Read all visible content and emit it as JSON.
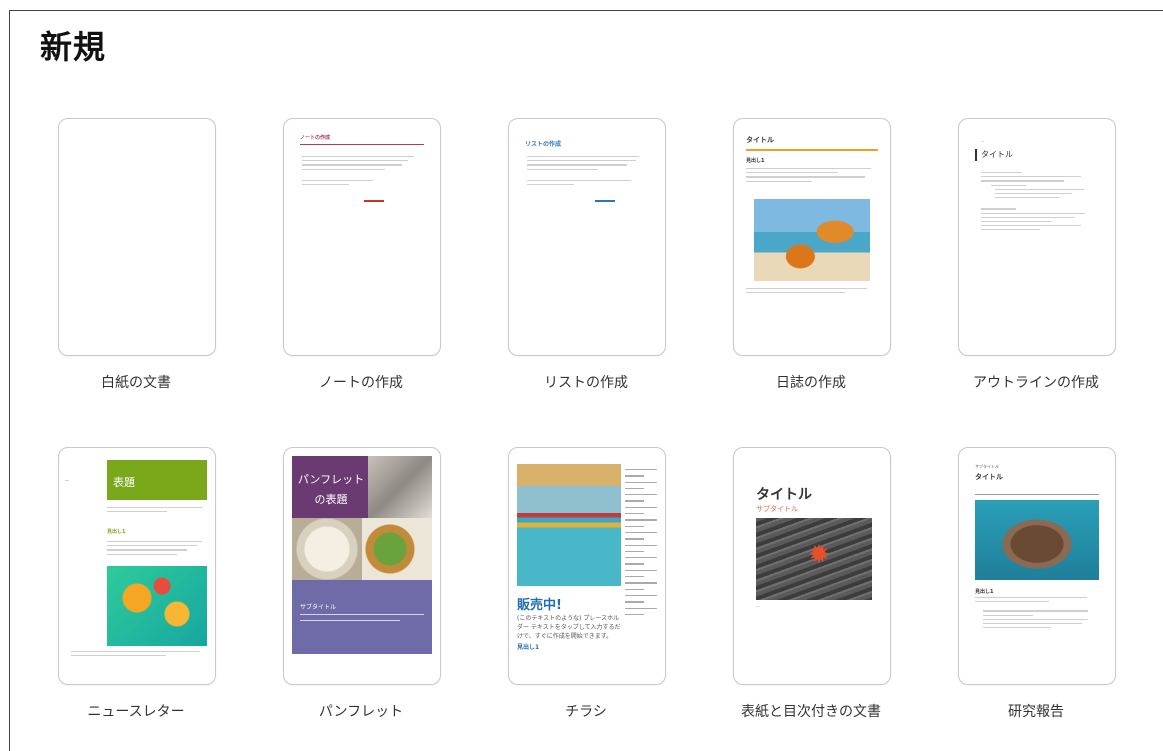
{
  "header": {
    "title": "新規"
  },
  "templates": [
    {
      "label": "白紙の文書"
    },
    {
      "label": "ノートの作成",
      "preview_title": "ノートの作成"
    },
    {
      "label": "リストの作成",
      "preview_title": "リストの作成"
    },
    {
      "label": "日誌の作成",
      "preview_title": "タイトル",
      "preview_heading": "見出し1"
    },
    {
      "label": "アウトラインの作成",
      "preview_title": "タイトル"
    },
    {
      "label": "ニュースレター",
      "preview_title": "表題",
      "preview_heading": "見出し1"
    },
    {
      "label": "パンフレット",
      "preview_title": "パンフレットの表題",
      "preview_subtitle": "サブタイトル"
    },
    {
      "label": "チラシ",
      "preview_title": "販売中!",
      "preview_text": "(このテキストのような) プレースホルダー テキストをタップして入力するだけで、すぐに作成を開始できます。",
      "preview_heading": "見出し1"
    },
    {
      "label": "表紙と目次付きの文書",
      "preview_title": "タイトル",
      "preview_subtitle": "サブタイトル"
    },
    {
      "label": "研究報告",
      "preview_small": "サブタイトル",
      "preview_title": "タイトル",
      "preview_heading": "見出し1"
    }
  ]
}
